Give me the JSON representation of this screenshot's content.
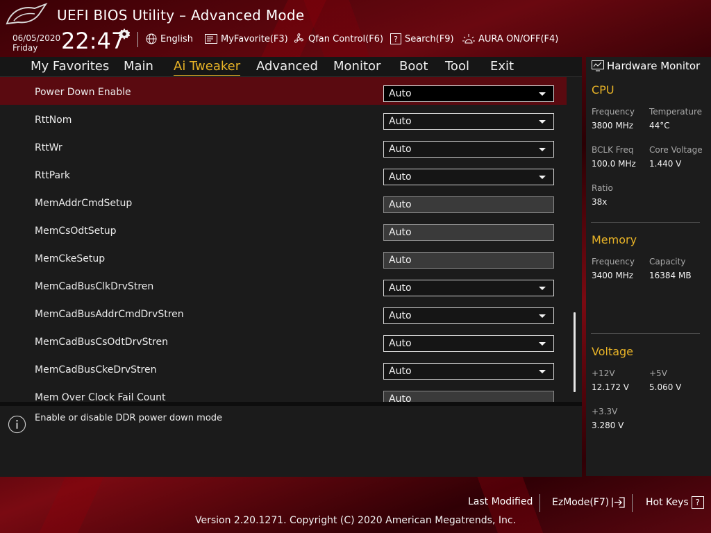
{
  "window": {
    "title": "UEFI BIOS Utility – Advanced Mode"
  },
  "clock": {
    "date": "06/05/2020",
    "day": "Friday",
    "time": "22:47"
  },
  "toolbar": {
    "language": "English",
    "myfavorite": "MyFavorite(F3)",
    "qfan": "Qfan Control(F6)",
    "search": "Search(F9)",
    "aura": "AURA ON/OFF(F4)"
  },
  "nav": {
    "tabs": [
      "My Favorites",
      "Main",
      "Ai Tweaker",
      "Advanced",
      "Monitor",
      "Boot",
      "Tool",
      "Exit"
    ],
    "active": "Ai Tweaker"
  },
  "settings": [
    {
      "label": "Power Down Enable",
      "value": "Auto",
      "type": "dropdown",
      "selected": true
    },
    {
      "label": "RttNom",
      "value": "Auto",
      "type": "dropdown"
    },
    {
      "label": "RttWr",
      "value": "Auto",
      "type": "dropdown"
    },
    {
      "label": "RttPark",
      "value": "Auto",
      "type": "dropdown"
    },
    {
      "label": "MemAddrCmdSetup",
      "value": "Auto",
      "type": "readonly"
    },
    {
      "label": "MemCsOdtSetup",
      "value": "Auto",
      "type": "readonly"
    },
    {
      "label": "MemCkeSetup",
      "value": "Auto",
      "type": "readonly"
    },
    {
      "label": "MemCadBusClkDrvStren",
      "value": "Auto",
      "type": "dropdown"
    },
    {
      "label": "MemCadBusAddrCmdDrvStren",
      "value": "Auto",
      "type": "dropdown"
    },
    {
      "label": "MemCadBusCsOdtDrvStren",
      "value": "Auto",
      "type": "dropdown"
    },
    {
      "label": "MemCadBusCkeDrvStren",
      "value": "Auto",
      "type": "dropdown"
    },
    {
      "label": "Mem Over Clock Fail Count",
      "value": "Auto",
      "type": "readonly"
    }
  ],
  "help": {
    "text": "Enable or disable DDR power down mode"
  },
  "hardware_monitor": {
    "title": "Hardware Monitor",
    "cpu": {
      "heading": "CPU",
      "frequency_label": "Frequency",
      "frequency": "3800 MHz",
      "temperature_label": "Temperature",
      "temperature": "44°C",
      "bclk_label": "BCLK Freq",
      "bclk": "100.0 MHz",
      "core_voltage_label": "Core Voltage",
      "core_voltage": "1.440 V",
      "ratio_label": "Ratio",
      "ratio": "38x"
    },
    "memory": {
      "heading": "Memory",
      "frequency_label": "Frequency",
      "frequency": "3400 MHz",
      "capacity_label": "Capacity",
      "capacity": "16384 MB"
    },
    "voltage": {
      "heading": "Voltage",
      "v12_label": "+12V",
      "v12": "12.172 V",
      "v5_label": "+5V",
      "v5": "5.060 V",
      "v33_label": "+3.3V",
      "v33": "3.280 V"
    }
  },
  "footer": {
    "last_modified": "Last Modified",
    "ezmode": "EzMode(F7)",
    "hotkeys": "Hot Keys",
    "hotkeys_key": "?",
    "copyright": "Version 2.20.1271. Copyright (C) 2020 American Megatrends, Inc."
  },
  "colors": {
    "accent": "#e8b327",
    "selected_row": "#5a0a10",
    "panel_bg": "#1b1b1b"
  }
}
